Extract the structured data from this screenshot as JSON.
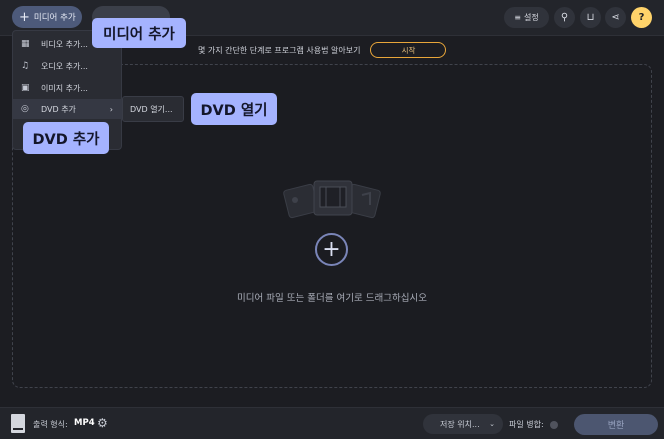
{
  "toolbar": {
    "add_media_icon": "+",
    "add_media_label": "미디어 추가",
    "settings_icon": "≡",
    "settings_label": "설정",
    "search_icon": "⚲",
    "cart_icon": "⊔",
    "share_icon": "⋖",
    "help_icon": "?"
  },
  "hint": {
    "text": "몇 가지 간단한 단계로 프로그램 사용법 알아보기",
    "start_label": "시작"
  },
  "add_menu": {
    "items": [
      {
        "icon": "▦",
        "label": "비디오 추가..."
      },
      {
        "icon": "♫",
        "label": "오디오 추가..."
      },
      {
        "icon": "▣",
        "label": "이미지 추가..."
      },
      {
        "icon": "◎",
        "label": "DVD 추가",
        "chevron": "›"
      }
    ],
    "submenu_label": "DVD 열기..."
  },
  "callouts": {
    "add_media": "미디어 추가",
    "open_dvd": "DVD 열기",
    "add_dvd": "DVD 추가"
  },
  "drop_zone": {
    "plus_icon": "+",
    "text": "미디어 파일 또는 폴더를 여기로 드래그하십시오"
  },
  "bottom": {
    "format_label": "출력 형식:",
    "format_value": "MP4",
    "gear_icon": "⚙",
    "save_location_label": "저장 위치...",
    "save_caret": "⌄",
    "merge_label": "파일 병합:",
    "convert_label": "변환"
  }
}
